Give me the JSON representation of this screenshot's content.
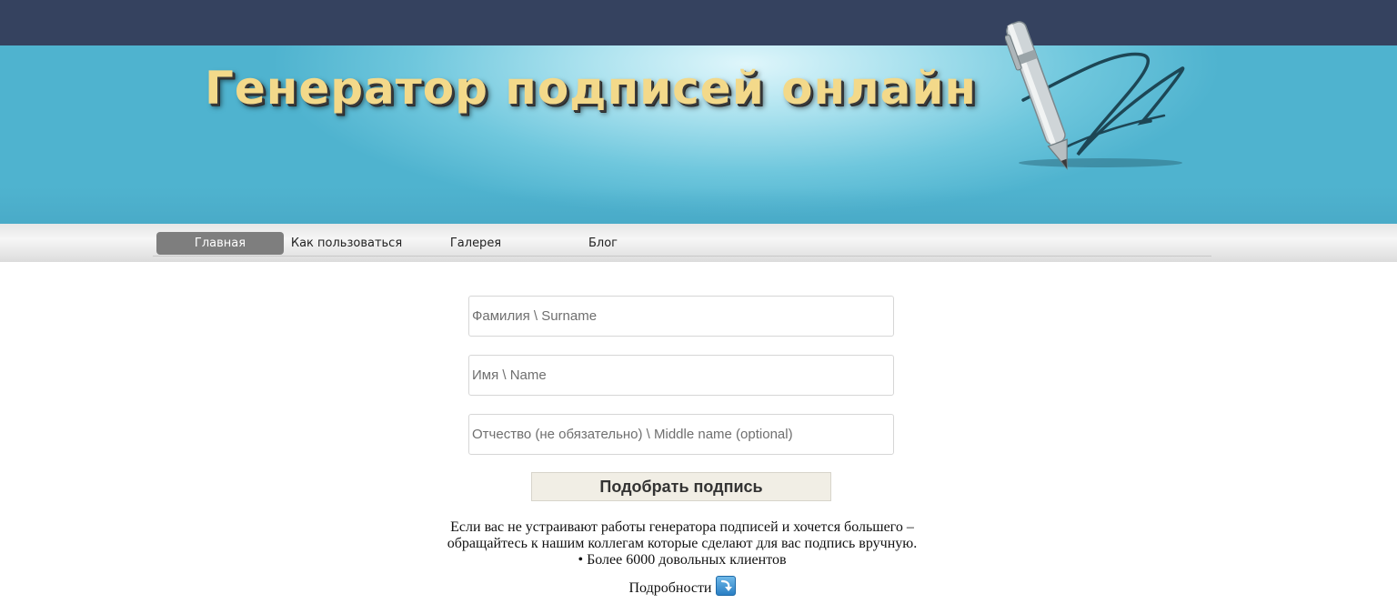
{
  "header": {
    "title": "Генератор подписей онлайн",
    "logo_icon": "pen-signature-icon"
  },
  "nav": {
    "items": [
      {
        "label": "Главная",
        "active": true
      },
      {
        "label": "Как пользоваться",
        "active": false
      },
      {
        "label": "Галерея",
        "active": false
      },
      {
        "label": "Блог",
        "active": false
      }
    ]
  },
  "form": {
    "surname_placeholder": "Фамилия \\ Surname",
    "surname_value": "",
    "name_placeholder": "Имя \\ Name",
    "name_value": "",
    "middle_placeholder": "Отчество (не обязательно) \\ Middle name (optional)",
    "middle_value": "",
    "submit_label": "Подобрать подпись"
  },
  "info": {
    "line1": "Если вас не устраивают работы генератора подписей и хочется большего –",
    "line2": "обращайтесь к нашим коллегам которые сделают для вас подпись вручную.",
    "line3": "• Более 6000 довольных клиентов",
    "details_label": "Подробности",
    "details_icon": "arrow-down-box-icon"
  },
  "colors": {
    "topbar": "#35425f",
    "banner": "#6fc7dd",
    "title": "#f3d98a",
    "nav_active": "#7e7e7e",
    "button": "#f1eee5"
  }
}
